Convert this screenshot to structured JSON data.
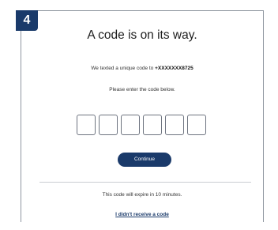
{
  "step": {
    "number": "4"
  },
  "dialog": {
    "title": "A code is on its way.",
    "texted_prefix": "We texted a unique code to ",
    "phone_masked": "+XXXXXXX8725",
    "instruction": "Please enter the code below.",
    "code_boxes": 6,
    "continue_label": "Continue",
    "expiry_notice": "This code will expire in 10 minutes.",
    "resend_link": "I didn't receive a code"
  },
  "colors": {
    "accent": "#1a3a6a",
    "border": "#8f96a0"
  }
}
